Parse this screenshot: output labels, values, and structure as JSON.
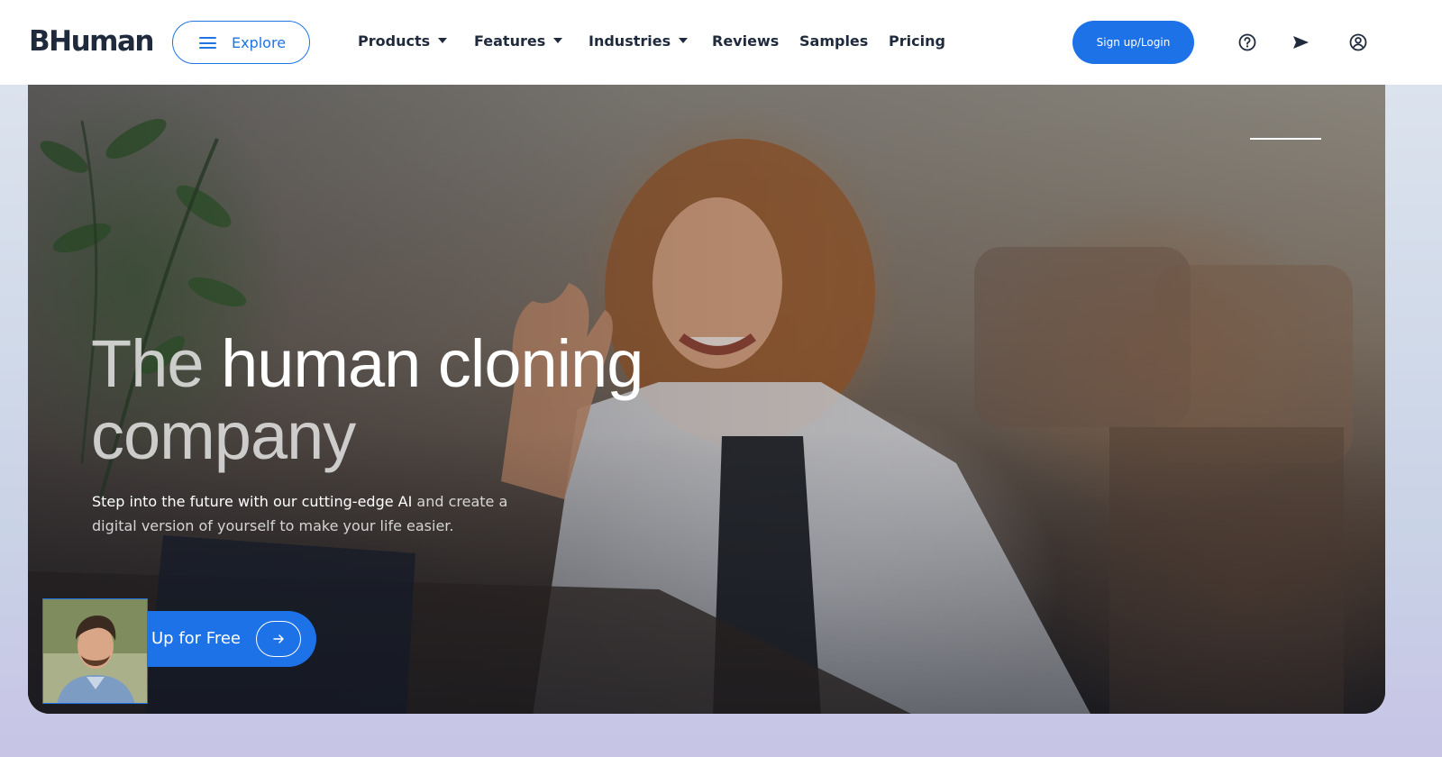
{
  "header": {
    "logo": "BHuman",
    "explore_label": "Explore",
    "nav": [
      {
        "label": "Products",
        "has_dropdown": true
      },
      {
        "label": "Features",
        "has_dropdown": true
      },
      {
        "label": "Industries",
        "has_dropdown": true
      },
      {
        "label": "Reviews",
        "has_dropdown": false
      },
      {
        "label": "Samples",
        "has_dropdown": false
      },
      {
        "label": "Pricing",
        "has_dropdown": false
      }
    ],
    "signup_label": "Sign up/Login",
    "icons": [
      "help-circle-icon",
      "send-icon",
      "user-circle-icon"
    ]
  },
  "hero": {
    "title_part1": "The ",
    "title_part2": "human cloning",
    "title_part3": "company",
    "subtitle_part1": "Step into the future with our cutting-edge AI",
    "subtitle_part2": " and create a digital version of yourself to make your life easier.",
    "cta_label": "Up for Free"
  },
  "colors": {
    "accent": "#1d72e8",
    "text_dark": "#1f2a3d",
    "header_bg": "#ffffff"
  }
}
